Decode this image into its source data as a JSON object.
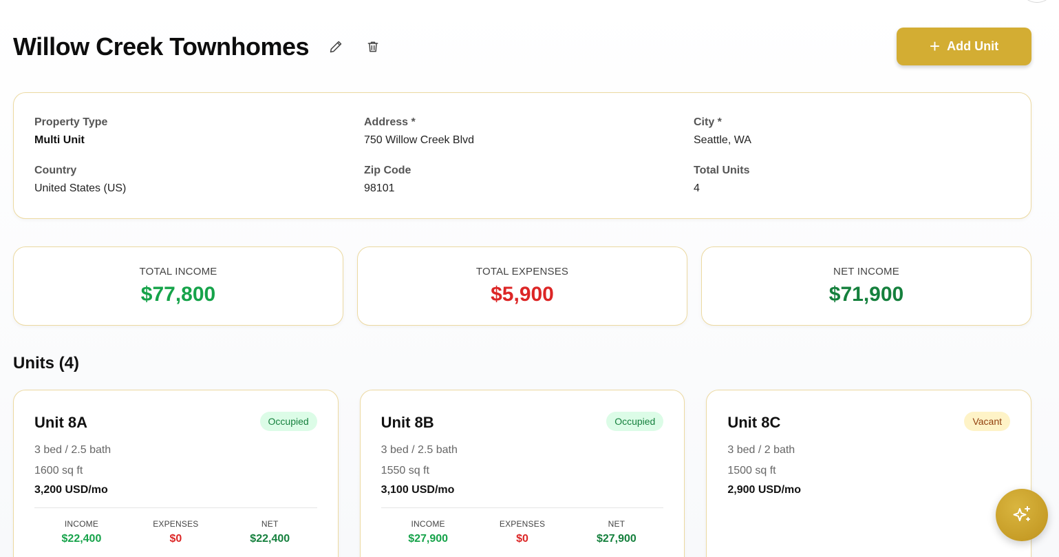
{
  "header": {
    "title": "Willow Creek Townhomes",
    "add_unit_label": "Add Unit"
  },
  "details": {
    "property_type": {
      "label": "Property Type",
      "value": "Multi Unit"
    },
    "address": {
      "label": "Address *",
      "value": "750 Willow Creek Blvd"
    },
    "city": {
      "label": "City *",
      "value": "Seattle, WA"
    },
    "country": {
      "label": "Country",
      "value": "United States (US)"
    },
    "zip": {
      "label": "Zip Code",
      "value": "98101"
    },
    "total_units": {
      "label": "Total Units",
      "value": "4"
    }
  },
  "summary": {
    "income": {
      "label": "TOTAL INCOME",
      "value": "$77,800"
    },
    "expenses": {
      "label": "TOTAL EXPENSES",
      "value": "$5,900"
    },
    "net": {
      "label": "NET INCOME",
      "value": "$71,900"
    }
  },
  "units_title": "Units (4)",
  "units": [
    {
      "name": "Unit 8A",
      "status": "Occupied",
      "beds": "3 bed / 2.5 bath",
      "sqft": "1600 sq ft",
      "rent": "3,200 USD/mo",
      "income_label": "INCOME",
      "income": "$22,400",
      "expenses_label": "EXPENSES",
      "expenses": "$0",
      "net_label": "NET",
      "net": "$22,400"
    },
    {
      "name": "Unit 8B",
      "status": "Occupied",
      "beds": "3 bed / 2.5 bath",
      "sqft": "1550 sq ft",
      "rent": "3,100 USD/mo",
      "income_label": "INCOME",
      "income": "$27,900",
      "expenses_label": "EXPENSES",
      "expenses": "$0",
      "net_label": "NET",
      "net": "$27,900"
    },
    {
      "name": "Unit 8C",
      "status": "Vacant",
      "beds": "3 bed / 2 bath",
      "sqft": "1500 sq ft",
      "rent": "2,900 USD/mo"
    }
  ],
  "icons": {
    "edit": "pencil-icon",
    "delete": "trash-icon",
    "add": "plus-icon",
    "assistant": "sparkles-icon"
  },
  "colors": {
    "accent": "#d3ad33",
    "income": "#16a34a",
    "expense": "#dc2626",
    "net": "#15803d",
    "card_border": "#ecd9a0"
  }
}
